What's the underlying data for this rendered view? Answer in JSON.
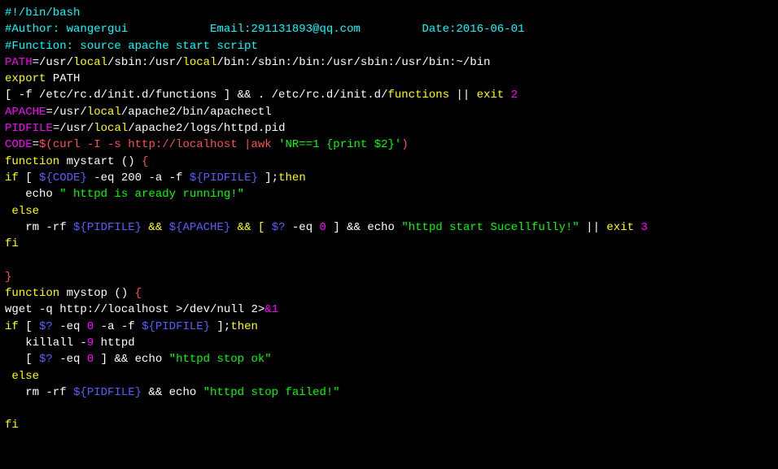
{
  "l1": {
    "a": "#!/bin/bash"
  },
  "l2": {
    "a": "#Author: wangergui            Email:291131893@qq.com         Date:2016-06-01"
  },
  "l3": {
    "a": "#Function: source apache start script"
  },
  "l4": {
    "a": "PATH",
    "b": "=/usr/",
    "c": "local",
    "d": "/sbin:/usr/",
    "e": "local",
    "f": "/bin:/sbin:/bin:/usr/sbin:/usr/bin:~/bin"
  },
  "l5": {
    "a": "export",
    "b": " PATH"
  },
  "l6": {
    "a": "[ -f /etc/rc.d/init.d/functions ] && . /etc/rc.d/init.d/",
    "b": "functions",
    "c": " || ",
    "d": "exit",
    "e": " 2"
  },
  "l7": {
    "a": "APACHE",
    "b": "=/usr/",
    "c": "local",
    "d": "/apache2/bin/apachectl"
  },
  "l8": {
    "a": "PIDFILE",
    "b": "=/usr/",
    "c": "local",
    "d": "/apache2/logs/httpd.pid"
  },
  "l9": {
    "a": "CODE",
    "b": "=",
    "c": "$(curl -I -s http://localhost |awk ",
    "d": "'NR==1 {print $2}'",
    "e": ")"
  },
  "l10": {
    "a": "function",
    "b": " mystart () ",
    "c": "{"
  },
  "l11": {
    "a": "if",
    "b": " [ ",
    "c": "${CODE}",
    "d": " -eq 200 -a -f ",
    "e": "${PIDFILE}",
    "f": " ];",
    "g": "then"
  },
  "l12": {
    "a": "   echo ",
    "b": "\" httpd is aready running!\""
  },
  "l13": {
    "a": " else"
  },
  "l14": {
    "a": "   rm -rf ",
    "b": "${PIDFILE}",
    "c": " && ",
    "d": "${APACHE}",
    "e": " && [ ",
    "f": "$?",
    "g": " -eq ",
    "h": "0",
    "i": " ] && echo ",
    "j": "\"httpd start Sucellfully!\"",
    "k": " || ",
    "l": "exit",
    "m": " 3"
  },
  "l15": {
    "a": "fi"
  },
  "l16": {
    "a": " "
  },
  "l17": {
    "a": "}"
  },
  "l18": {
    "a": "function",
    "b": " mystop () ",
    "c": "{"
  },
  "l19": {
    "a": "wget -q http://localhost >/dev/null 2>",
    "b": "&1"
  },
  "l20": {
    "a": "if",
    "b": " [ ",
    "c": "$?",
    "d": " -eq ",
    "e": "0",
    "f": " -a -f ",
    "g": "${PIDFILE}",
    "h": " ];",
    "i": "then"
  },
  "l21": {
    "a": "   killall -",
    "b": "9",
    "c": " httpd"
  },
  "l22": {
    "a": "   [ ",
    "b": "$?",
    "c": " -eq ",
    "d": "0",
    "e": " ] && echo ",
    "f": "\"httpd stop ok\""
  },
  "l23": {
    "a": " else"
  },
  "l24": {
    "a": "   rm -rf ",
    "b": "${PIDFILE}",
    "c": " && echo ",
    "d": "\"httpd stop failed!\""
  },
  "l25": {
    "a": " "
  },
  "l26": {
    "a": "fi"
  }
}
